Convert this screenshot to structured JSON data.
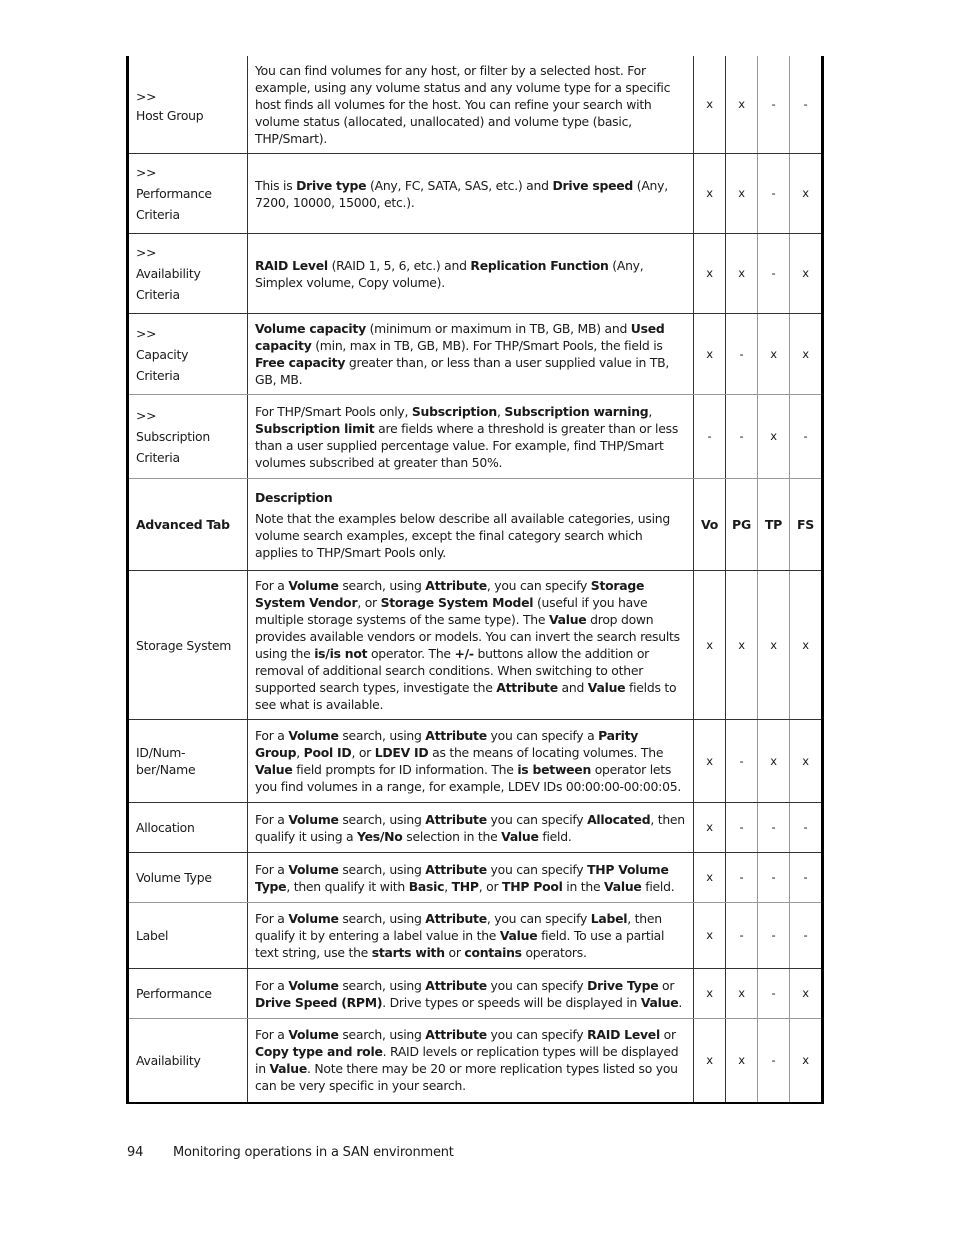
{
  "table": {
    "columns": [
      "Vo",
      "PG",
      "TP",
      "FS"
    ],
    "rows": [
      {
        "name_lines": [
          ">>",
          "Host Group"
        ],
        "desc": [
          {
            "t": "You can find volumes for any host, or filter by a selected host. For example, using any volume status and any volume type for a specific host finds all volumes for the host. You can refine your search with volume status (allocated, unallocated) and volume type (basic, THP/Smart).",
            "b": false
          }
        ],
        "marks": [
          "x",
          "x",
          "-",
          "-"
        ]
      },
      {
        "name_lines": [
          ">>",
          "Performance",
          "Criteria"
        ],
        "desc": [
          {
            "t": "This is ",
            "b": false
          },
          {
            "t": "Drive type",
            "b": true
          },
          {
            "t": " (Any, FC, SATA, SAS, etc.) and ",
            "b": false
          },
          {
            "t": "Drive speed",
            "b": true
          },
          {
            "t": " (Any, 7200, 10000, 15000, etc.).",
            "b": false
          }
        ],
        "marks": [
          "x",
          "x",
          "-",
          "x"
        ]
      },
      {
        "name_lines": [
          ">>",
          "Availability",
          "Criteria"
        ],
        "desc": [
          {
            "t": "RAID Level",
            "b": true
          },
          {
            "t": " (RAID 1, 5, 6, etc.) and ",
            "b": false
          },
          {
            "t": "Replication Function",
            "b": true
          },
          {
            "t": " (Any, Simplex volume, Copy volume).",
            "b": false
          }
        ],
        "marks": [
          "x",
          "x",
          "-",
          "x"
        ]
      },
      {
        "name_lines": [
          ">>",
          "Capacity",
          "Criteria"
        ],
        "desc": [
          {
            "t": "Volume capacity",
            "b": true
          },
          {
            "t": " (minimum or maximum in TB, GB, MB) and ",
            "b": false
          },
          {
            "t": "Used capacity",
            "b": true
          },
          {
            "t": " (min, max in TB, GB, MB). For THP/Smart Pools, the field is ",
            "b": false
          },
          {
            "t": "Free capacity",
            "b": true
          },
          {
            "t": " greater than, or less than a user supplied value in TB, GB, MB.",
            "b": false
          }
        ],
        "marks": [
          "x",
          "-",
          "x",
          "x"
        ]
      },
      {
        "name_lines": [
          ">>",
          "Subscription",
          "Criteria"
        ],
        "desc": [
          {
            "t": "For THP/Smart Pools only, ",
            "b": false
          },
          {
            "t": "Subscription",
            "b": true
          },
          {
            "t": ", ",
            "b": false
          },
          {
            "t": "Subscription warning",
            "b": true
          },
          {
            "t": ", ",
            "b": false
          },
          {
            "t": "Subscription limit",
            "b": true
          },
          {
            "t": " are fields where a threshold is greater than or less than a user supplied percentage value. For example, find THP/Smart volumes subscribed at greater than 50%.",
            "b": false
          }
        ],
        "marks": [
          "-",
          "-",
          "x",
          "-"
        ]
      },
      {
        "header": true,
        "name_lines": [
          "Advanced Tab"
        ],
        "desc_title": "Description",
        "desc": [
          {
            "t": "Note that the examples below describe all available categories, using volume search examples, except the final category search which applies to THP/Smart Pools only.",
            "b": false
          }
        ],
        "marks": [
          "Vo",
          "PG",
          "TP",
          "FS"
        ]
      },
      {
        "name_lines": [
          "Storage System"
        ],
        "desc": [
          {
            "t": "For a ",
            "b": false
          },
          {
            "t": "Volume",
            "b": true
          },
          {
            "t": " search, using ",
            "b": false
          },
          {
            "t": "Attribute",
            "b": true
          },
          {
            "t": ", you can specify ",
            "b": false
          },
          {
            "t": "Storage System Vendor",
            "b": true
          },
          {
            "t": ", or ",
            "b": false
          },
          {
            "t": "Storage System Model",
            "b": true
          },
          {
            "t": " (useful if you have multiple storage systems of the same type). The ",
            "b": false
          },
          {
            "t": "Value",
            "b": true
          },
          {
            "t": " drop down provides available vendors or models. You can invert the search results using the ",
            "b": false
          },
          {
            "t": "is/is not",
            "b": true
          },
          {
            "t": " operator. The ",
            "b": false
          },
          {
            "t": "+/-",
            "b": true
          },
          {
            "t": " buttons allow the addition or removal of additional search conditions. When switching to other supported search types, investigate the ",
            "b": false
          },
          {
            "t": "Attribute",
            "b": true
          },
          {
            "t": " and ",
            "b": false
          },
          {
            "t": "Value",
            "b": true
          },
          {
            "t": " fields to see what is available.",
            "b": false
          }
        ],
        "marks": [
          "x",
          "x",
          "x",
          "x"
        ]
      },
      {
        "name_lines": [
          "ID/Num-",
          "ber/Name"
        ],
        "desc": [
          {
            "t": "For a ",
            "b": false
          },
          {
            "t": "Volume",
            "b": true
          },
          {
            "t": " search, using ",
            "b": false
          },
          {
            "t": "Attribute",
            "b": true
          },
          {
            "t": " you can specify a ",
            "b": false
          },
          {
            "t": "Parity Group",
            "b": true
          },
          {
            "t": ", ",
            "b": false
          },
          {
            "t": "Pool ID",
            "b": true
          },
          {
            "t": ", or ",
            "b": false
          },
          {
            "t": "LDEV ID",
            "b": true
          },
          {
            "t": " as the means of locating volumes. The ",
            "b": false
          },
          {
            "t": "Value",
            "b": true
          },
          {
            "t": " field prompts for ID information. The ",
            "b": false
          },
          {
            "t": "is between",
            "b": true
          },
          {
            "t": " operator lets you find volumes in a range, for example, LDEV IDs 00:00:00-00:00:05.",
            "b": false
          }
        ],
        "marks": [
          "x",
          "-",
          "x",
          "x"
        ]
      },
      {
        "name_lines": [
          "Allocation"
        ],
        "desc": [
          {
            "t": "For a ",
            "b": false
          },
          {
            "t": "Volume",
            "b": true
          },
          {
            "t": " search, using ",
            "b": false
          },
          {
            "t": "Attribute",
            "b": true
          },
          {
            "t": " you can specify ",
            "b": false
          },
          {
            "t": "Allocated",
            "b": true
          },
          {
            "t": ", then qualify it using a ",
            "b": false
          },
          {
            "t": "Yes/No",
            "b": true
          },
          {
            "t": " selection in the ",
            "b": false
          },
          {
            "t": "Value",
            "b": true
          },
          {
            "t": " field.",
            "b": false
          }
        ],
        "marks": [
          "x",
          "-",
          "-",
          "-"
        ]
      },
      {
        "name_lines": [
          "Volume Type"
        ],
        "desc": [
          {
            "t": "For a ",
            "b": false
          },
          {
            "t": "Volume",
            "b": true
          },
          {
            "t": " search, using ",
            "b": false
          },
          {
            "t": "Attribute",
            "b": true
          },
          {
            "t": " you can specify ",
            "b": false
          },
          {
            "t": "THP Volume Type",
            "b": true
          },
          {
            "t": ", then qualify it with ",
            "b": false
          },
          {
            "t": "Basic",
            "b": true
          },
          {
            "t": ", ",
            "b": false
          },
          {
            "t": "THP",
            "b": true
          },
          {
            "t": ", or ",
            "b": false
          },
          {
            "t": "THP Pool",
            "b": true
          },
          {
            "t": " in the ",
            "b": false
          },
          {
            "t": "Value",
            "b": true
          },
          {
            "t": " field.",
            "b": false
          }
        ],
        "marks": [
          "x",
          "-",
          "-",
          "-"
        ]
      },
      {
        "name_lines": [
          "Label"
        ],
        "desc": [
          {
            "t": "For a ",
            "b": false
          },
          {
            "t": "Volume",
            "b": true
          },
          {
            "t": " search, using ",
            "b": false
          },
          {
            "t": "Attribute",
            "b": true
          },
          {
            "t": ", you can specify ",
            "b": false
          },
          {
            "t": "Label",
            "b": true
          },
          {
            "t": ", then qualify it by entering a label value in the ",
            "b": false
          },
          {
            "t": "Value",
            "b": true
          },
          {
            "t": " field. To use a partial text string, use the ",
            "b": false
          },
          {
            "t": "starts with",
            "b": true
          },
          {
            "t": " or ",
            "b": false
          },
          {
            "t": "contains",
            "b": true
          },
          {
            "t": " operators.",
            "b": false
          }
        ],
        "marks": [
          "x",
          "-",
          "-",
          "-"
        ]
      },
      {
        "name_lines": [
          "Performance"
        ],
        "desc": [
          {
            "t": "For a ",
            "b": false
          },
          {
            "t": "Volume",
            "b": true
          },
          {
            "t": " search, using ",
            "b": false
          },
          {
            "t": "Attribute",
            "b": true
          },
          {
            "t": " you can specify ",
            "b": false
          },
          {
            "t": "Drive Type",
            "b": true
          },
          {
            "t": " or ",
            "b": false
          },
          {
            "t": "Drive Speed (RPM)",
            "b": true
          },
          {
            "t": ". Drive types or speeds will be displayed in ",
            "b": false
          },
          {
            "t": "Value",
            "b": true
          },
          {
            "t": ".",
            "b": false
          }
        ],
        "marks": [
          "x",
          "x",
          "-",
          "x"
        ]
      },
      {
        "name_lines": [
          "Availability"
        ],
        "desc": [
          {
            "t": "For a ",
            "b": false
          },
          {
            "t": "Volume",
            "b": true
          },
          {
            "t": " search, using ",
            "b": false
          },
          {
            "t": "Attribute",
            "b": true
          },
          {
            "t": " you can specify ",
            "b": false
          },
          {
            "t": "RAID Level",
            "b": true
          },
          {
            "t": " or ",
            "b": false
          },
          {
            "t": "Copy type and role",
            "b": true
          },
          {
            "t": ". RAID levels or replication types will be displayed in ",
            "b": false
          },
          {
            "t": "Value",
            "b": true
          },
          {
            "t": ". Note there may be 20 or more replication types listed so you can be very specific in your search.",
            "b": false
          }
        ],
        "marks": [
          "x",
          "x",
          "-",
          "x"
        ]
      }
    ]
  },
  "footer": {
    "page_number": "94",
    "section_title": "Monitoring operations in a SAN environment"
  }
}
